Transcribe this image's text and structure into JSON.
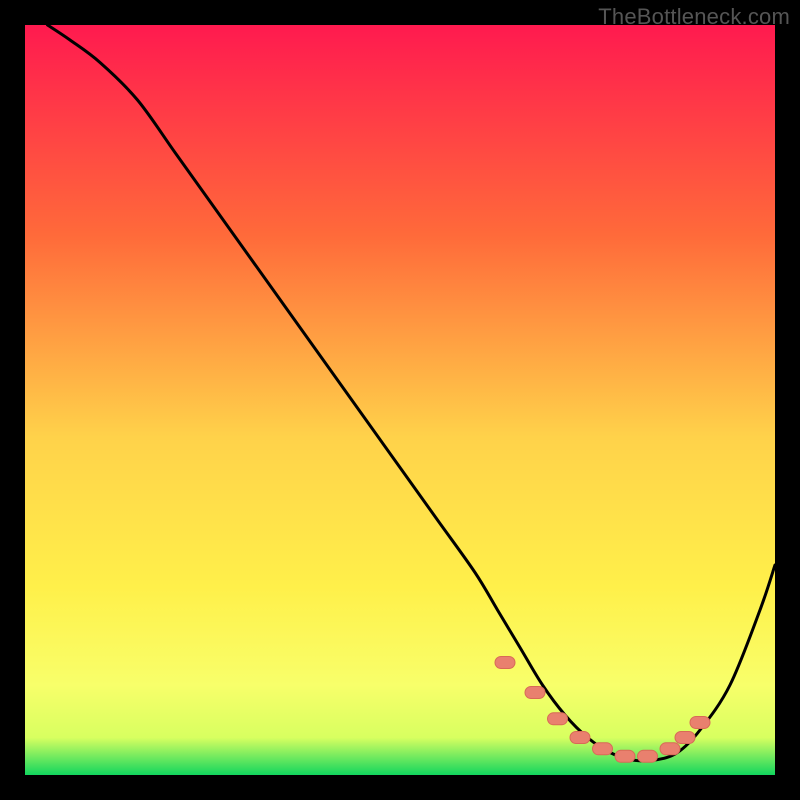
{
  "watermark": "TheBottleneck.com",
  "colors": {
    "frame": "#000000",
    "grad_top": "#ff1a4f",
    "grad_mid1": "#ff6a3a",
    "grad_mid2": "#ffd24a",
    "grad_mid3": "#fff04a",
    "grad_low1": "#f8ff6a",
    "grad_low2": "#d8ff60",
    "grad_bottom": "#12d65e",
    "curve": "#000000",
    "marker_fill": "#e9806e",
    "marker_stroke": "#d86a57",
    "watermark": "#555555"
  },
  "chart_data": {
    "type": "line",
    "title": "",
    "xlabel": "",
    "ylabel": "",
    "xlim": [
      0,
      100
    ],
    "ylim": [
      0,
      100
    ],
    "series": [
      {
        "name": "bottleneck-curve",
        "x": [
          3,
          6,
          10,
          15,
          20,
          25,
          30,
          35,
          40,
          45,
          50,
          55,
          60,
          63,
          66,
          69,
          72,
          75,
          78,
          81,
          84,
          87,
          90,
          94,
          98,
          100
        ],
        "y": [
          100,
          98,
          95,
          90,
          83,
          76,
          69,
          62,
          55,
          48,
          41,
          34,
          27,
          22,
          17,
          12,
          8,
          5,
          3,
          2,
          2,
          3,
          6,
          12,
          22,
          28
        ]
      }
    ],
    "markers": {
      "name": "highlighted-range",
      "x": [
        64,
        68,
        71,
        74,
        77,
        80,
        83,
        86,
        88,
        90
      ],
      "y": [
        15,
        11,
        7.5,
        5,
        3.5,
        2.5,
        2.5,
        3.5,
        5,
        7
      ]
    }
  }
}
